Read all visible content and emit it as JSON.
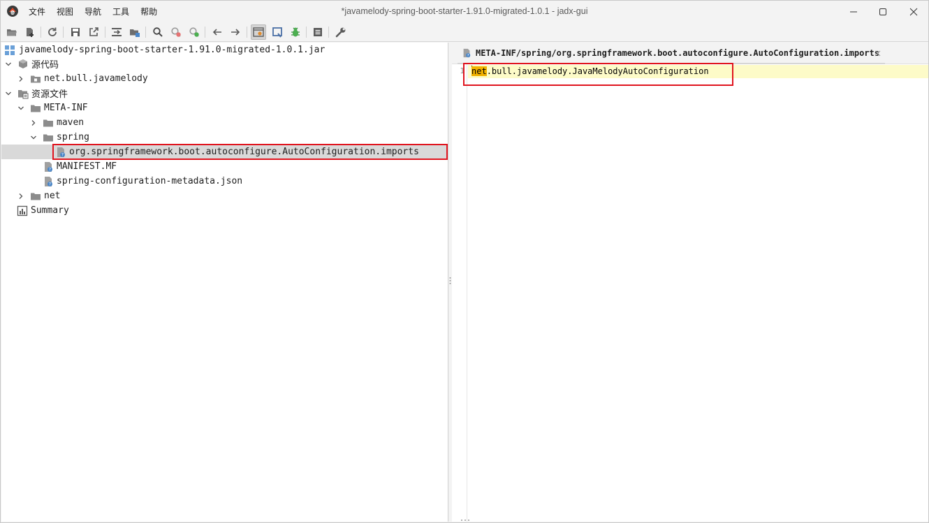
{
  "window": {
    "title": "*javamelody-spring-boot-starter-1.91.0-migrated-1.0.1 - jadx-gui"
  },
  "menu": [
    {
      "label": "文件"
    },
    {
      "label": "视图"
    },
    {
      "label": "导航"
    },
    {
      "label": "工具"
    },
    {
      "label": "帮助"
    }
  ],
  "toolbar": {
    "icons": [
      "open-folder-icon",
      "add-file-icon",
      "sync-icon",
      "save-icon",
      "export-icon",
      "sync-tree-icon",
      "flatten-packages-icon",
      "search-icon",
      "find-class-icon",
      "find-usage-icon",
      "back-icon",
      "forward-icon",
      "deobfuscation-icon",
      "quark-icon",
      "debug-icon",
      "log-icon",
      "preferences-icon"
    ]
  },
  "tree": {
    "root": {
      "label": "javamelody-spring-boot-starter-1.91.0-migrated-1.0.1.jar"
    },
    "source": {
      "label": "源代码"
    },
    "source_pkg": {
      "label": "net.bull.javamelody"
    },
    "resources": {
      "label": "资源文件"
    },
    "meta_inf": {
      "label": "META-INF"
    },
    "maven": {
      "label": "maven"
    },
    "spring": {
      "label": "spring"
    },
    "imports_file": {
      "label": "org.springframework.boot.autoconfigure.AutoConfiguration.imports"
    },
    "manifest": {
      "label": "MANIFEST.MF"
    },
    "metadata_json": {
      "label": "spring-configuration-metadata.json"
    },
    "net": {
      "label": "net"
    },
    "summary": {
      "label": "Summary"
    }
  },
  "editor": {
    "tab_label": "META-INF/spring/org.springframework.boot.autoconfigure.AutoConfiguration.imports",
    "lines": [
      {
        "number": "1",
        "match": "net",
        "rest": ".bull.javamelody.JavaMelodyAutoConfiguration"
      }
    ]
  },
  "colors": {
    "highlight_box": "#e0141e",
    "match_highlight": "#f2b200",
    "current_line": "#fdfbc8",
    "selection": "#d9d9d9"
  }
}
